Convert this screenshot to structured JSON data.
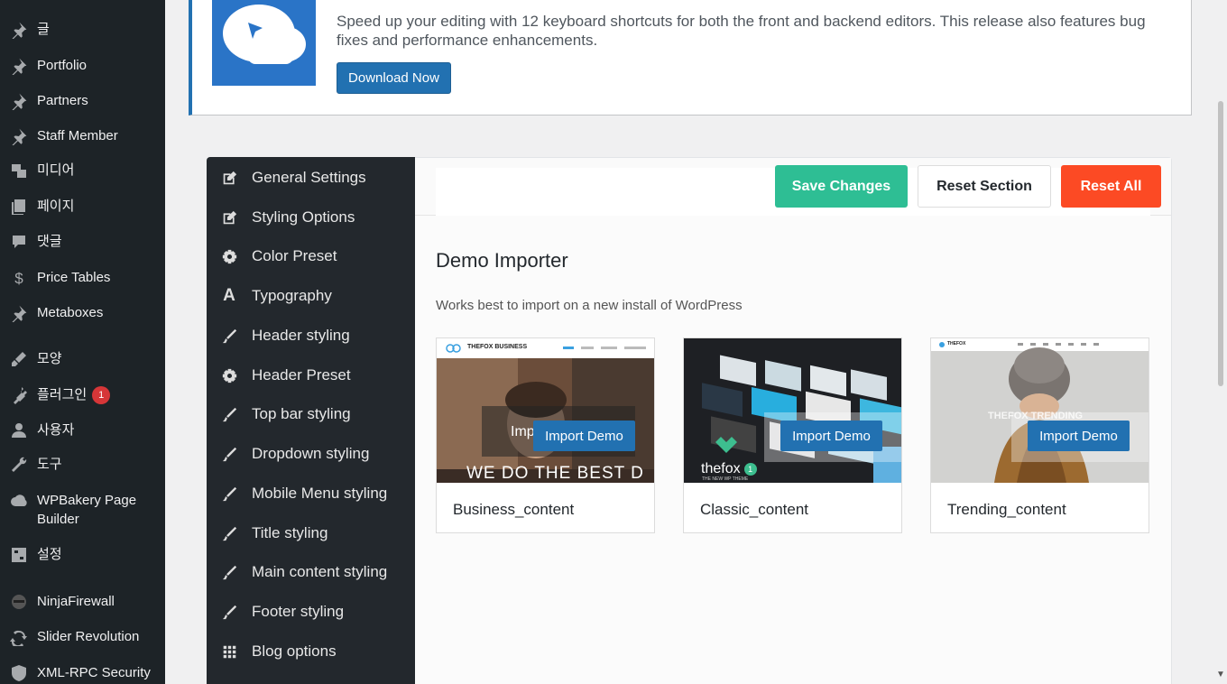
{
  "wp_menu": [
    {
      "label": "글",
      "icon": "pin-icon"
    },
    {
      "label": "Portfolio",
      "icon": "pin-icon"
    },
    {
      "label": "Partners",
      "icon": "pin-icon"
    },
    {
      "label": "Staff Member",
      "icon": "pin-icon"
    },
    {
      "label": "미디어",
      "icon": "media-icon"
    },
    {
      "label": "페이지",
      "icon": "pages-icon"
    },
    {
      "label": "댓글",
      "icon": "comments-icon"
    },
    {
      "label": "Price Tables",
      "icon": "dollar-icon"
    },
    {
      "label": "Metaboxes",
      "icon": "pin-icon"
    },
    {
      "label": "모양",
      "icon": "appearance-icon"
    },
    {
      "label": "플러그인",
      "icon": "plugins-icon",
      "badge": "1"
    },
    {
      "label": "사용자",
      "icon": "users-icon"
    },
    {
      "label": "도구",
      "icon": "tools-icon"
    },
    {
      "label": "WPBakery Page Builder",
      "icon": "wpbakery-icon"
    },
    {
      "label": "설정",
      "icon": "settings-icon"
    },
    {
      "label": "NinjaFirewall",
      "icon": "ninja-icon"
    },
    {
      "label": "Slider Revolution",
      "icon": "slider-icon"
    },
    {
      "label": "XML-RPC Security",
      "icon": "shield-icon"
    }
  ],
  "notice": {
    "text": "Speed up your editing with 12 keyboard shortcuts for both the front and backend editors. This release also features bug fixes and performance enhancements.",
    "button": "Download Now"
  },
  "options_nav": [
    {
      "label": "General Settings",
      "icon": "edit-icon"
    },
    {
      "label": "Styling Options",
      "icon": "edit-icon"
    },
    {
      "label": "Color Preset",
      "icon": "gear-icon"
    },
    {
      "label": "Typography",
      "icon": "font-icon"
    },
    {
      "label": "Header styling",
      "icon": "brush-icon"
    },
    {
      "label": "Header Preset",
      "icon": "gear-icon"
    },
    {
      "label": "Top bar styling",
      "icon": "brush-icon"
    },
    {
      "label": "Dropdown styling",
      "icon": "brush-icon"
    },
    {
      "label": "Mobile Menu styling",
      "icon": "brush-icon"
    },
    {
      "label": "Title styling",
      "icon": "brush-icon"
    },
    {
      "label": "Main content styling",
      "icon": "brush-icon"
    },
    {
      "label": "Footer styling",
      "icon": "brush-icon"
    },
    {
      "label": "Blog options",
      "icon": "grid-icon"
    }
  ],
  "toolbar": {
    "save": "Save Changes",
    "reset_section": "Reset Section",
    "reset_all": "Reset All"
  },
  "section": {
    "title": "Demo Importer",
    "description": "Works best to import on a new install of WordPress"
  },
  "demos": [
    {
      "name": "Business_content",
      "button": "Import Demo",
      "brand": "THEFOX BUSINESS",
      "tagline": "WE DO THE BEST D",
      "hint": "Imp"
    },
    {
      "name": "Classic_content",
      "button": "Import Demo",
      "brand": "thefox",
      "version": "1",
      "tagline": "THE NEW WP THEME"
    },
    {
      "name": "Trending_content",
      "button": "Import Demo",
      "brand": "THEFOX",
      "tagline": "THEFOX TRENDING"
    }
  ],
  "colors": {
    "sidebar_bg": "#1d2327",
    "save": "#2ebe94",
    "reset_all": "#fc4a24",
    "primary": "#2271b1"
  }
}
